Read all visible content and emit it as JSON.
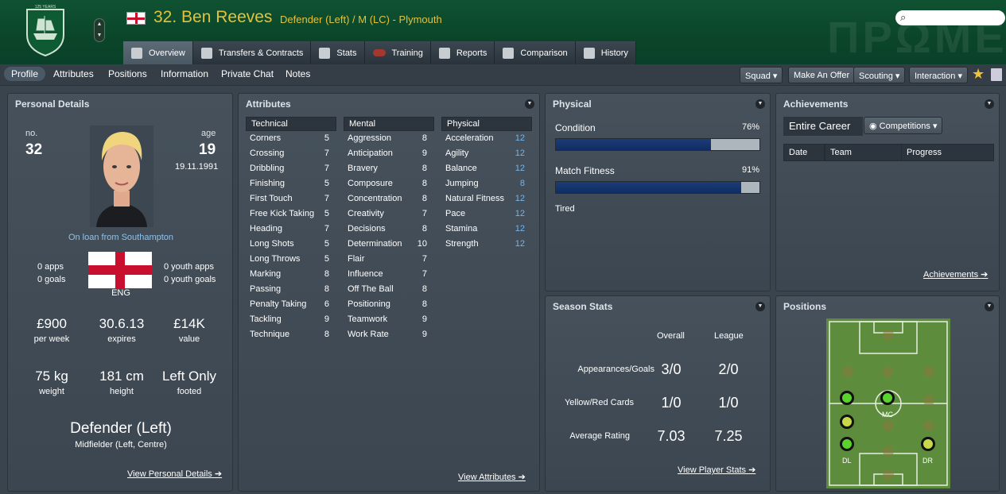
{
  "player": {
    "title": "32. Ben Reeves",
    "subtitle": "Defender (Left) / M (LC) - Plymouth"
  },
  "crest": {
    "motto": "125 YEARS"
  },
  "tabs": [
    {
      "label": "Overview",
      "icon": "profile-card-icon"
    },
    {
      "label": "Transfers & Contracts",
      "icon": "document-icon"
    },
    {
      "label": "Stats",
      "icon": "bar-chart-icon"
    },
    {
      "label": "Training",
      "icon": "rugby-ball-icon"
    },
    {
      "label": "Reports",
      "icon": "clipboard-icon"
    },
    {
      "label": "Comparison",
      "icon": "comparison-icon"
    },
    {
      "label": "History",
      "icon": "history-book-icon"
    }
  ],
  "subnav": {
    "items": [
      "Profile",
      "Attributes",
      "Positions",
      "Information",
      "Private Chat",
      "Notes"
    ],
    "buttons": [
      "Squad",
      "Make An Offer",
      "Scouting",
      "Interaction"
    ]
  },
  "personal": {
    "title": "Personal Details",
    "no_label": "no.",
    "number": "32",
    "age_label": "age",
    "age": "19",
    "dob": "19.11.1991",
    "loan": "On loan from Southampton",
    "apps": "0 apps",
    "goals": "0 goals",
    "youth_apps": "0 youth apps",
    "youth_goals": "0 youth goals",
    "nation": "ENG",
    "wage": "£900",
    "wage_label": "per week",
    "expires": "30.6.13",
    "expires_label": "expires",
    "value": "£14K",
    "value_label": "value",
    "weight": "75 kg",
    "weight_label": "weight",
    "height": "181 cm",
    "height_label": "height",
    "footed": "Left Only",
    "footed_label": "footed",
    "position": "Defender (Left)",
    "position_sub": "Midfielder (Left, Centre)",
    "link": "View Personal Details"
  },
  "attributes": {
    "title": "Attributes",
    "technical_header": "Technical",
    "mental_header": "Mental",
    "physical_header": "Physical",
    "technical": [
      {
        "name": "Corners",
        "value": "5"
      },
      {
        "name": "Crossing",
        "value": "7"
      },
      {
        "name": "Dribbling",
        "value": "7"
      },
      {
        "name": "Finishing",
        "value": "5"
      },
      {
        "name": "First Touch",
        "value": "7"
      },
      {
        "name": "Free Kick Taking",
        "value": "5"
      },
      {
        "name": "Heading",
        "value": "7"
      },
      {
        "name": "Long Shots",
        "value": "5"
      },
      {
        "name": "Long Throws",
        "value": "5"
      },
      {
        "name": "Marking",
        "value": "8"
      },
      {
        "name": "Passing",
        "value": "8"
      },
      {
        "name": "Penalty Taking",
        "value": "6"
      },
      {
        "name": "Tackling",
        "value": "9"
      },
      {
        "name": "Technique",
        "value": "8"
      }
    ],
    "mental": [
      {
        "name": "Aggression",
        "value": "8"
      },
      {
        "name": "Anticipation",
        "value": "9"
      },
      {
        "name": "Bravery",
        "value": "8"
      },
      {
        "name": "Composure",
        "value": "8"
      },
      {
        "name": "Concentration",
        "value": "8"
      },
      {
        "name": "Creativity",
        "value": "7"
      },
      {
        "name": "Decisions",
        "value": "8"
      },
      {
        "name": "Determination",
        "value": "10"
      },
      {
        "name": "Flair",
        "value": "7"
      },
      {
        "name": "Influence",
        "value": "7"
      },
      {
        "name": "Off The Ball",
        "value": "8"
      },
      {
        "name": "Positioning",
        "value": "8"
      },
      {
        "name": "Teamwork",
        "value": "9"
      },
      {
        "name": "Work Rate",
        "value": "9"
      }
    ],
    "physical": [
      {
        "name": "Acceleration",
        "value": "12"
      },
      {
        "name": "Agility",
        "value": "12"
      },
      {
        "name": "Balance",
        "value": "12"
      },
      {
        "name": "Jumping",
        "value": "8"
      },
      {
        "name": "Natural Fitness",
        "value": "12"
      },
      {
        "name": "Pace",
        "value": "12"
      },
      {
        "name": "Stamina",
        "value": "12"
      },
      {
        "name": "Strength",
        "value": "12"
      }
    ],
    "link": "View Attributes"
  },
  "physical": {
    "title": "Physical",
    "condition_label": "Condition",
    "condition": "76%",
    "condition_fraction": 0.76,
    "fitness_label": "Match Fitness",
    "fitness": "91%",
    "fitness_fraction": 0.91,
    "status": "Tired"
  },
  "achievements": {
    "title": "Achievements",
    "scope": "Entire Career",
    "filter": "Competitions",
    "columns": [
      "Date",
      "Team",
      "Progress"
    ],
    "link": "Achievements"
  },
  "season": {
    "title": "Season Stats",
    "col_overall": "Overall",
    "col_league": "League",
    "rows": [
      {
        "label": "Appearances/Goals",
        "overall": "3/0",
        "league": "2/0"
      },
      {
        "label": "Yellow/Red Cards",
        "overall": "1/0",
        "league": "1/0"
      },
      {
        "label": "Average Rating",
        "overall": "7.03",
        "league": "7.25"
      }
    ],
    "link": "View Player Stats"
  },
  "positions": {
    "title": "Positions",
    "labels": {
      "mc": "MC",
      "dl": "DL",
      "dr": "DR"
    }
  }
}
